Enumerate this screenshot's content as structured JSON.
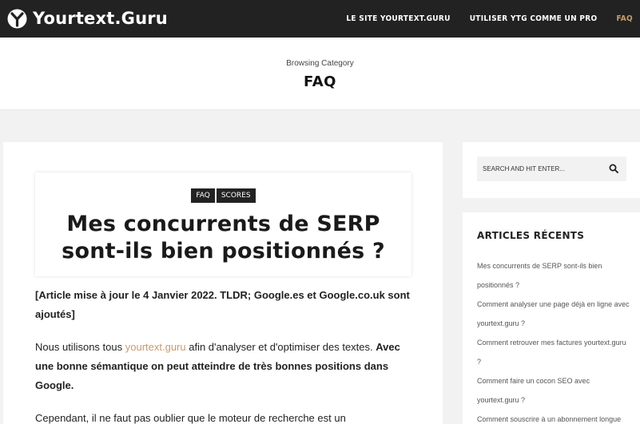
{
  "brand": {
    "name": "Yourtext.Guru",
    "logo_icon": "yourtext-guru-logo-icon"
  },
  "nav": {
    "items": [
      {
        "label": "LE SITE YOURTEXT.GURU",
        "active": false
      },
      {
        "label": "UTILISER YTG COMME UN PRO",
        "active": false
      },
      {
        "label": "FAQ",
        "active": true
      }
    ]
  },
  "category": {
    "browsing": "Browsing Category",
    "title": "FAQ"
  },
  "post": {
    "tags": [
      "FAQ",
      "SCORES"
    ],
    "title": "Mes concurrents de SERP sont-ils bien positionnés ?",
    "update_note": "[Article mise à jour le 4 Janvier 2022. TLDR; Google.es et Google.co.uk sont ajoutés]",
    "para2_prefix": "Nous utilisons tous ",
    "para2_link": "yourtext.guru",
    "para2_mid": " afin d'analyser et d'optimiser des textes. ",
    "para2_bold": "Avec une bonne sémantique on peut atteindre de très bonnes positions dans Google.",
    "para3": "Cependant, il ne faut pas oublier que le moteur de recherche est un"
  },
  "sidebar": {
    "search": {
      "placeholder": "SEARCH AND HIT ENTER..."
    },
    "recent": {
      "title": "ARTICLES RÉCENTS",
      "items": [
        "Mes concurrents de SERP sont-ils bien positionnés ?",
        "Comment analyser une page déjà en ligne avec yourtext.guru ?",
        "Comment retrouver mes factures yourtext.guru ?",
        "Comment faire un cocon SEO avec yourtext.guru ?",
        "Comment souscrire à un abonnement longue"
      ]
    }
  },
  "colors": {
    "accent": "#c89b6e",
    "topbar": "#222222"
  }
}
